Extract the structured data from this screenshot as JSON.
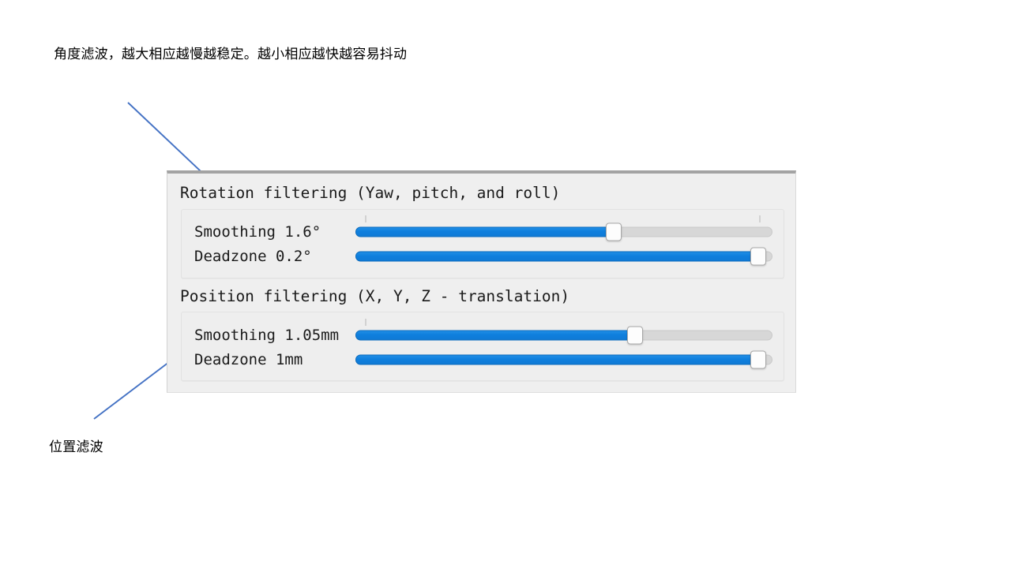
{
  "annotations": {
    "top_note": "角度滤波，越大相应越慢越稳定。越小相应越快越容易抖动",
    "bottom_note": "位置滤波",
    "arrow_color": "#4472c4"
  },
  "panel": {
    "sections": [
      {
        "id": "rotation",
        "title": "Rotation filtering (Yaw, pitch, and roll)",
        "rows": [
          {
            "name": "Smoothing",
            "value": "1.6°",
            "percent": 62,
            "ticks": [
              2.5,
              97
            ]
          },
          {
            "name": "Deadzone",
            "value": "0.2°",
            "percent": 96.5,
            "ticks": []
          }
        ]
      },
      {
        "id": "position",
        "title": "Position filtering (X, Y, Z - translation)",
        "rows": [
          {
            "name": "Smoothing",
            "value": "1.05mm",
            "percent": 67,
            "ticks": [
              2.5
            ]
          },
          {
            "name": "Deadzone",
            "value": "1mm",
            "percent": 96.5,
            "ticks": []
          }
        ]
      }
    ]
  },
  "colors": {
    "slider_fill": "#0f7fdd",
    "slider_track": "#d7d7d7",
    "panel_background": "#efefef",
    "group_background": "#eeeeee"
  }
}
